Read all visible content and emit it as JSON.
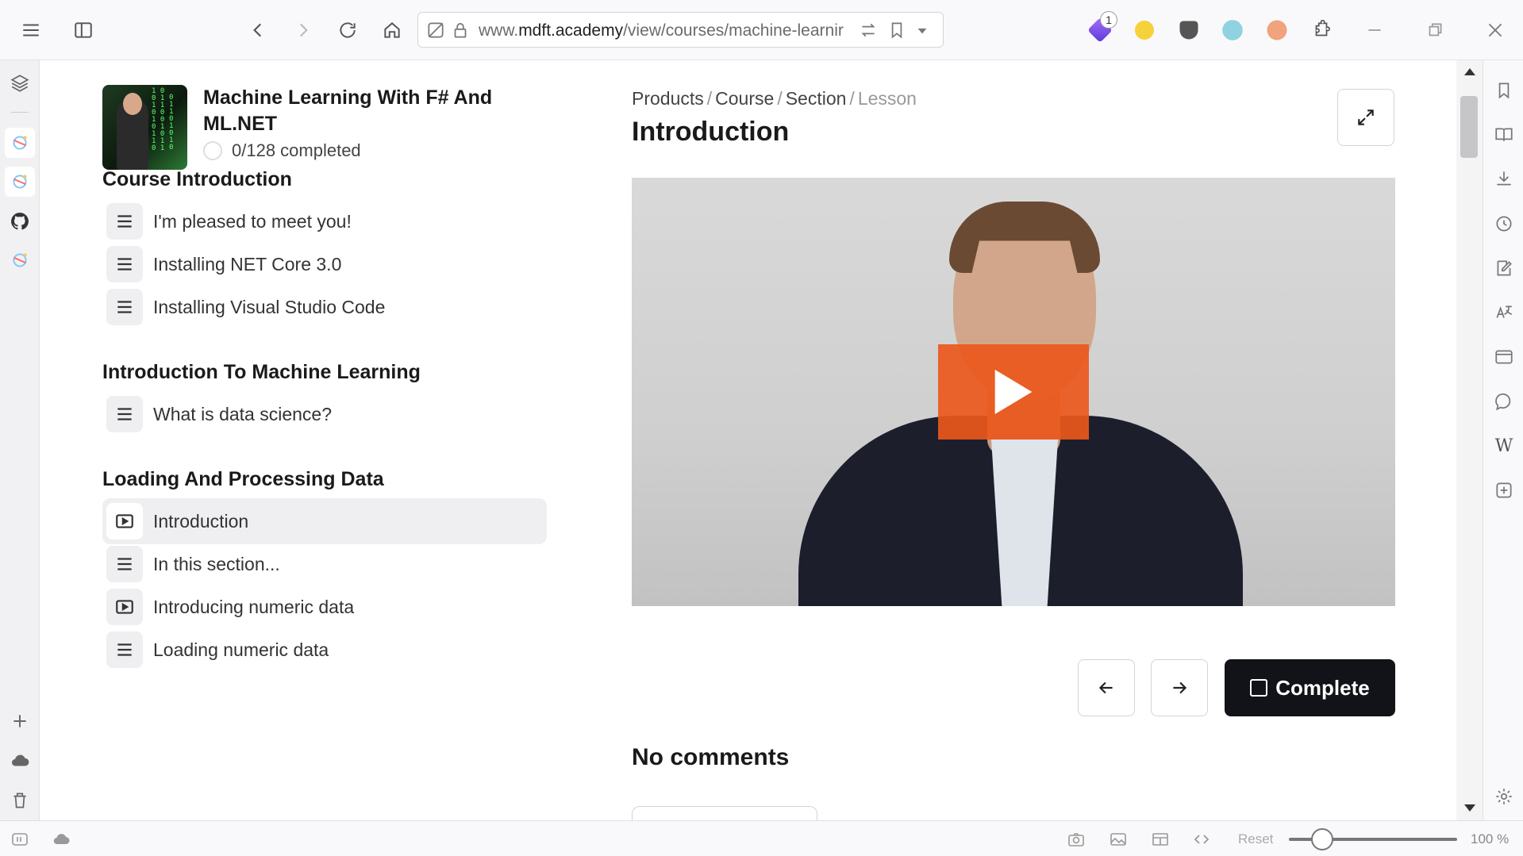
{
  "browser": {
    "url_prefix": "www.",
    "url_domain": "mdft.academy",
    "url_path": "/view/courses/machine-learnir",
    "extension_badge": "1"
  },
  "course": {
    "title": "Machine Learning With F# And ML.NET",
    "progress": "0/128 completed"
  },
  "sections": [
    {
      "title": "Course Introduction",
      "lessons": [
        {
          "label": "I'm pleased to meet you!",
          "icon": "text-lines-icon"
        },
        {
          "label": "Installing NET Core 3.0",
          "icon": "text-lines-icon"
        },
        {
          "label": "Installing Visual Studio Code",
          "icon": "text-lines-icon"
        }
      ]
    },
    {
      "title": "Introduction To Machine Learning",
      "lessons": [
        {
          "label": "What is data science?",
          "icon": "text-lines-icon"
        }
      ]
    },
    {
      "title": "Loading And Processing Data",
      "lessons": [
        {
          "label": "Introduction",
          "icon": "video-icon",
          "active": true
        },
        {
          "label": "In this section...",
          "icon": "text-lines-icon"
        },
        {
          "label": "Introducing numeric data",
          "icon": "video-icon"
        },
        {
          "label": "Loading numeric data",
          "icon": "text-lines-icon"
        }
      ]
    }
  ],
  "breadcrumb": {
    "items": [
      "Products",
      "Course",
      "Section"
    ],
    "current": "Lesson",
    "separator": "/"
  },
  "lesson": {
    "title": "Introduction",
    "complete_label": "Complete",
    "comments_label": "No comments"
  },
  "statusbar": {
    "reset_label": "Reset",
    "zoom": "100 %"
  },
  "colors": {
    "accent": "#EA581C",
    "primary_button": "#111318",
    "active_row": "#EFEFF1"
  }
}
